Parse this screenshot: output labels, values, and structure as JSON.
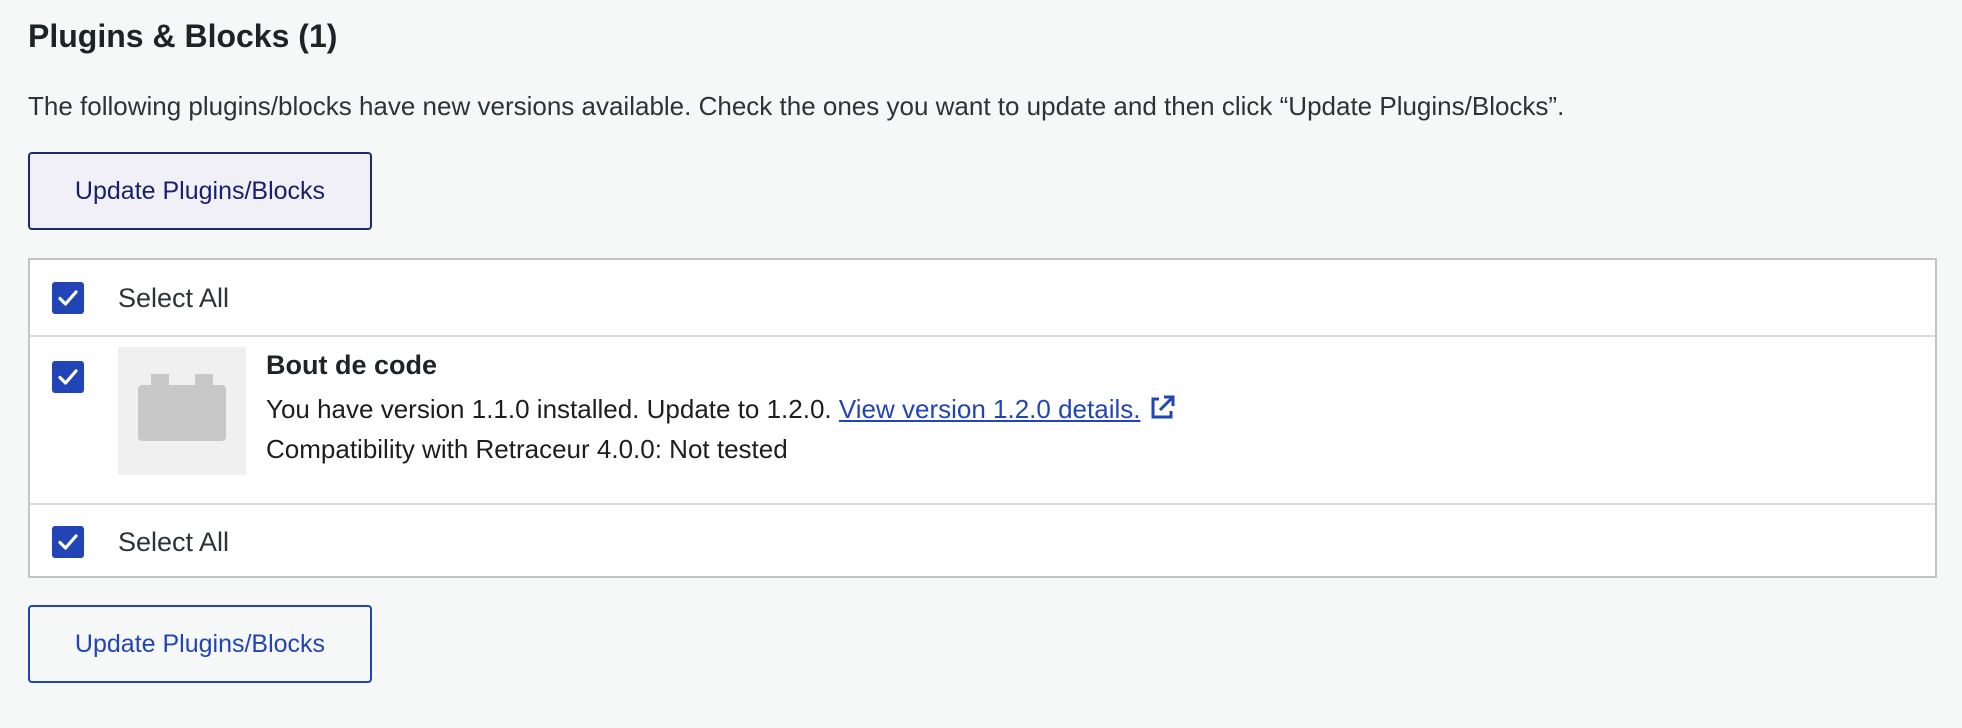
{
  "section": {
    "title": "Plugins & Blocks (1)",
    "intro": "The following plugins/blocks have new versions available. Check the ones you want to update and then click “Update Plugins/Blocks”."
  },
  "buttons": {
    "update_top": "Update Plugins/Blocks",
    "update_bottom": "Update Plugins/Blocks"
  },
  "table": {
    "select_all_top": "Select All",
    "select_all_bottom": "Select All",
    "plugins": [
      {
        "name": "Bout de code",
        "version_text": "You have version 1.1.0 installed. Update to 1.2.0. ",
        "details_link": "View version 1.2.0 details.",
        "compatibility": "Compatibility with Retraceur 4.0.0: Not tested",
        "checked": true
      }
    ]
  },
  "colors": {
    "accent": "#2145b6",
    "background": "#f6f7f7",
    "border": "#c3c4c7"
  },
  "icons": [
    "checkmark-icon",
    "plugin-placeholder-icon",
    "external-link-icon"
  ]
}
